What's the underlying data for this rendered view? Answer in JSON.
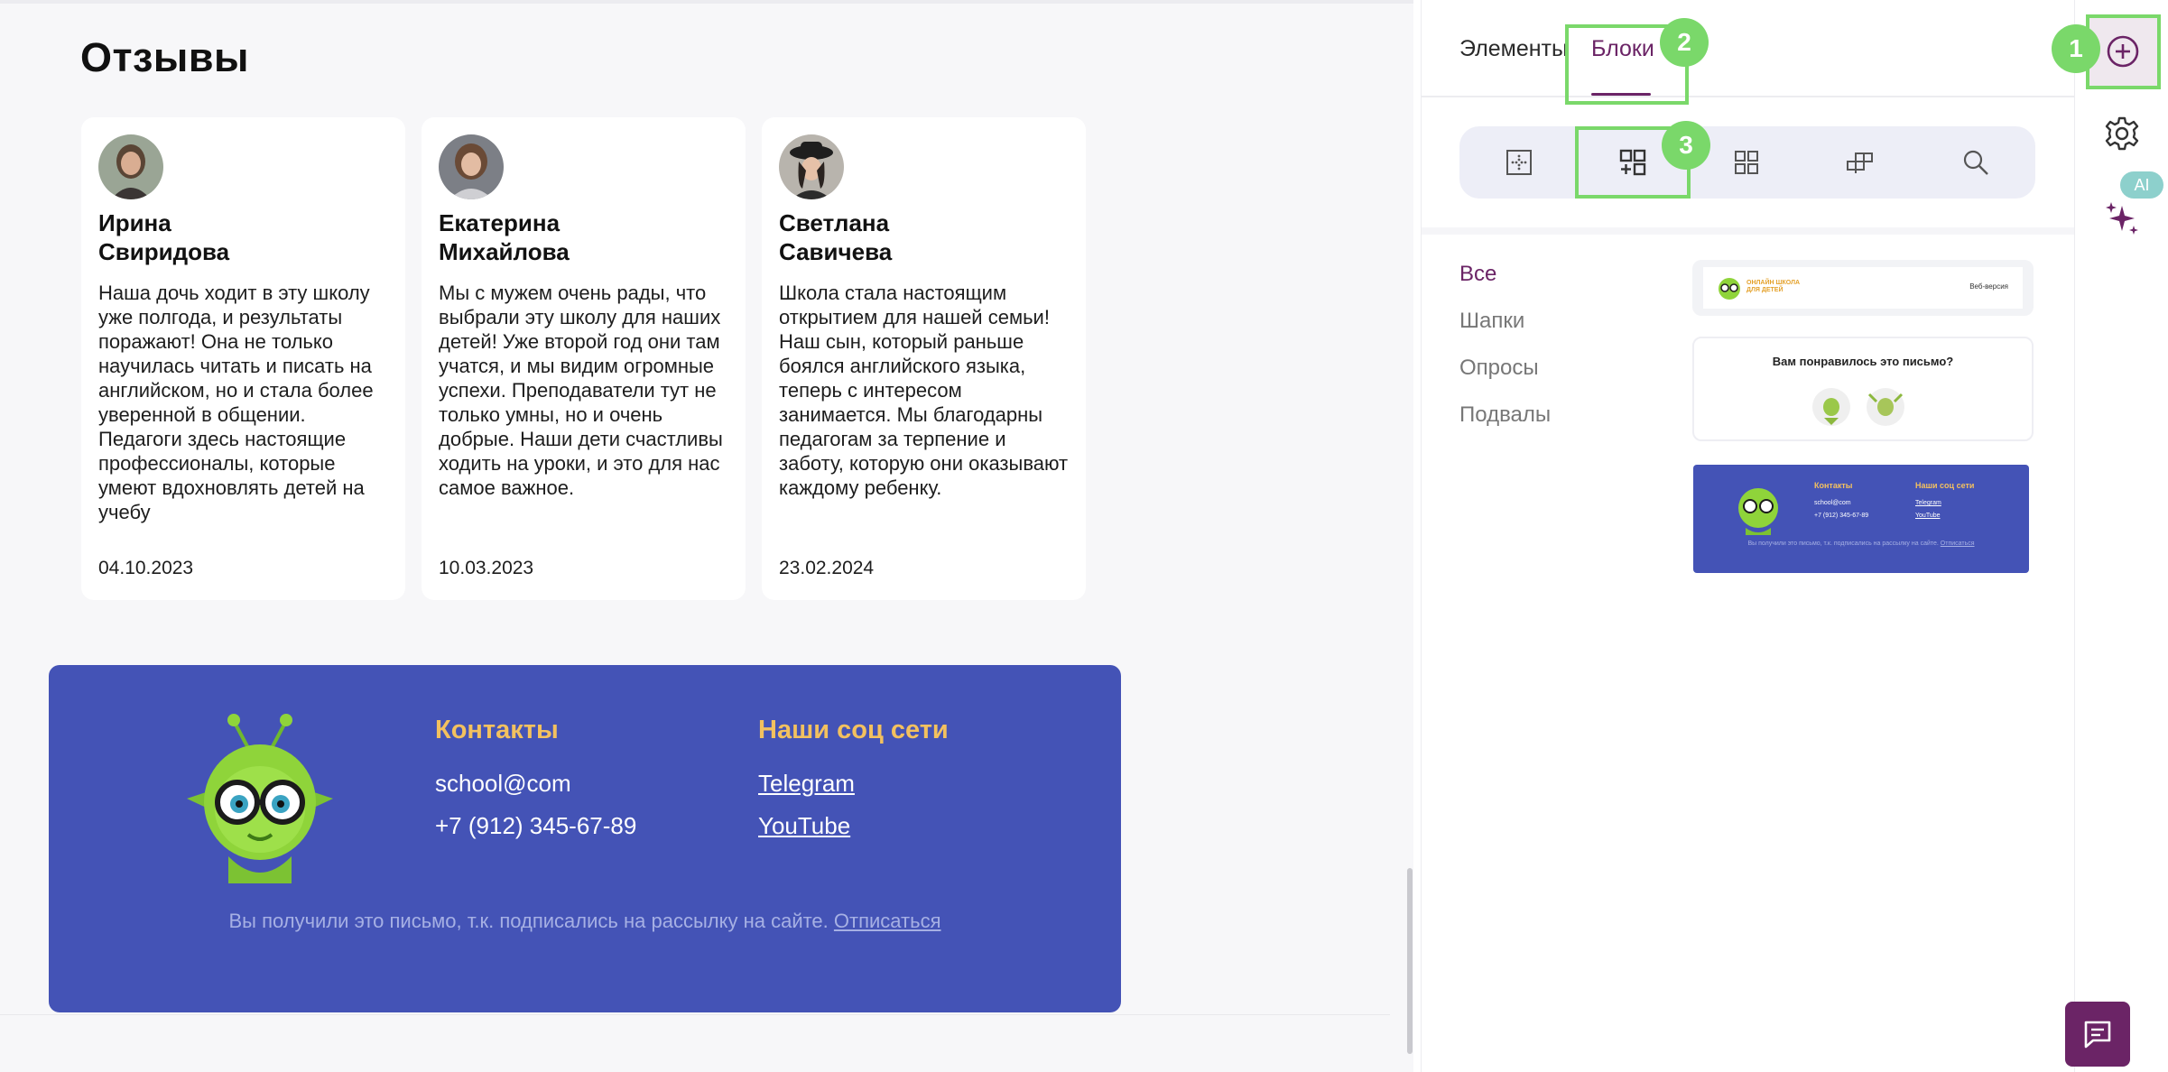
{
  "canvas": {
    "reviews_title": "Отзывы",
    "reviews": [
      {
        "name": "Ирина\nСвиридова",
        "text": "Наша дочь ходит в эту школу уже полгода, и результаты поражают! Она не только научилась читать и писать на английском, но и стала более уверенной в общении. Педагоги здесь настоящие профессионалы, которые умеют вдохновлять детей на учебу",
        "date": "04.10.2023"
      },
      {
        "name": "Екатерина\nМихайлова",
        "text": "Мы с мужем очень рады, что выбрали эту школу для наших детей! Уже второй год они там учатся, и мы видим огромные успехи. Преподаватели тут не только умны, но и очень добрые. Наши дети счастливы ходить на уроки, и это для нас самое важное.",
        "date": "10.03.2023"
      },
      {
        "name": "Светлана\nСавичева",
        "text": "Школа стала настоящим открытием для нашей семьи! Наш сын, который раньше боялся английского языка, теперь с интересом занимается. Мы благодарны педагогам за терпение и заботу, которую они оказывают каждому ребенку.",
        "date": "23.02.2024"
      }
    ],
    "footer": {
      "contacts_title": "Контакты",
      "email": "school@com",
      "phone": "+7 (912) 345-67-89",
      "social_title": "Наши соц сети",
      "telegram": "Telegram",
      "youtube": "YouTube",
      "note": "Вы получили это письмо, т.к. подписались на рассылку на сайте.",
      "unsubscribe": "Отписаться"
    }
  },
  "panel": {
    "tabs": [
      {
        "label": "Элементы"
      },
      {
        "label": "Блоки"
      }
    ],
    "icon_bar": [
      "grid-dotted-icon",
      "blocks-add-icon",
      "grid-four-icon",
      "layout-blocks-icon",
      "search-icon"
    ],
    "categories": [
      "Все",
      "Шапки",
      "Опросы",
      "Подвалы"
    ],
    "thumbnails": {
      "header_brand": "ОНЛАЙН ШКОЛА ДЛЯ ДЕТЕЙ",
      "header_web_version": "Веб-версия",
      "survey_question": "Вам понравилось это письмо?",
      "footer_contacts": "Контакты",
      "footer_social": "Наши соц сети",
      "footer_email": "school@com",
      "footer_phone": "+7 (912) 345-67-89",
      "footer_telegram": "Telegram",
      "footer_youtube": "YouTube",
      "footer_note": "Вы получили это письмо, т.к. подписались на рассылку на сайте.",
      "footer_unsub": "Отписаться"
    }
  },
  "rail": {
    "ai_badge": "AI"
  },
  "markers": [
    "1",
    "2",
    "3"
  ],
  "colors": {
    "accent": "#6b2466",
    "footer_bg": "#4453b6",
    "footer_heading": "#f3c15f",
    "highlight": "#7ad86a"
  }
}
